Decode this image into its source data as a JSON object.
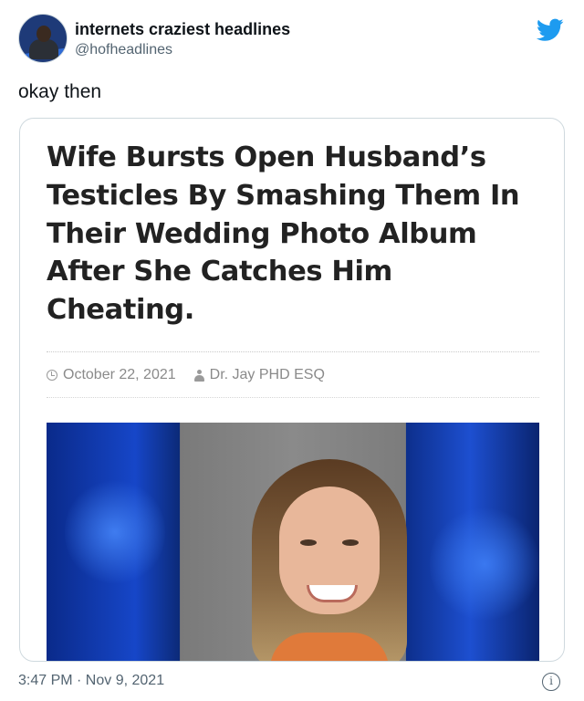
{
  "account": {
    "display_name": "internets craziest headlines",
    "handle": "@hofheadlines",
    "avatar_icon": "profile-avatar"
  },
  "tweet": {
    "text": "okay then",
    "timestamp": "3:47 PM · Nov 9, 2021"
  },
  "article": {
    "headline": "Wife Bursts Open Husband’s Testicles By Smashing Them In Their Wedding Photo Album After She Catches Him Cheating.",
    "date": "October 22, 2021",
    "author": "Dr. Jay PHD ESQ",
    "date_icon": "clock-icon",
    "author_icon": "user-icon"
  },
  "icons": {
    "brand": "twitter-bird-icon",
    "info": "info-icon"
  },
  "colors": {
    "brand_blue": "#1d9bf0",
    "text_primary": "#0f1419",
    "text_secondary": "#536471",
    "headline": "#222222"
  }
}
